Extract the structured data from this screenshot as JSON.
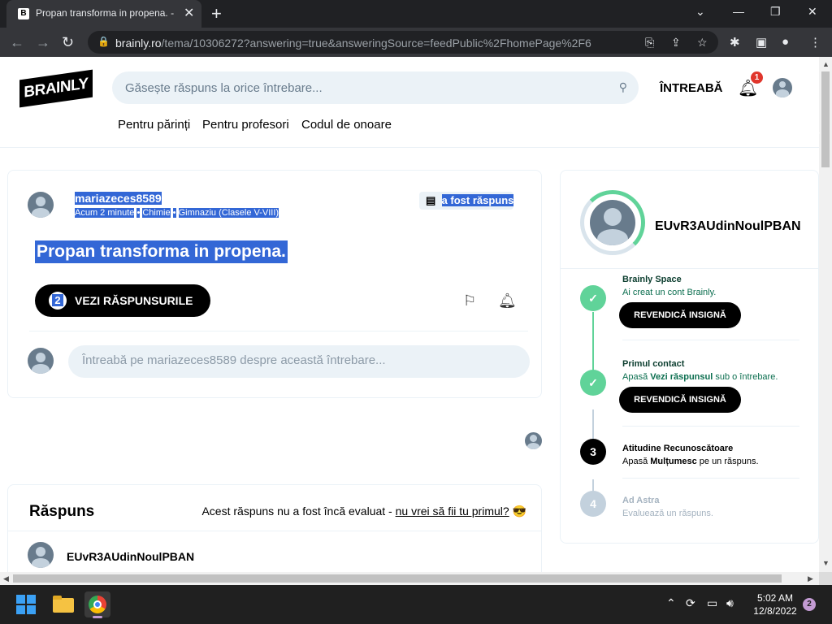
{
  "browser": {
    "tab_title": "Propan transforma in propena. -",
    "tab_favicon": "B",
    "url_host": "brainly.ro",
    "url_path": "/tema/10306272?answering=true&answeringSource=feedPublic%2FhomePage%2F6"
  },
  "header": {
    "logo": "BRAINLY",
    "search_placeholder": "Găsește răspuns la orice întrebare...",
    "ask_label": "ÎNTREABĂ",
    "notification_count": "1",
    "nav": [
      "Pentru părinți",
      "Pentru profesori",
      "Codul de onoare"
    ]
  },
  "question": {
    "author": "mariazeces8589",
    "time": "Acum 2 minute",
    "subject": "Chimie",
    "level": "Gimnaziu (Clasele V-VIII)",
    "status": "a fost răspuns",
    "title": "Propan transforma in propena.",
    "answers_count": "2",
    "view_answers_label": "VEZI RĂSPUNSURILE",
    "comment_placeholder": "Întreabă pe mariazeces8589 despre această întrebare..."
  },
  "answer": {
    "heading": "Răspuns",
    "note_prefix": "Acest răspuns nu a fost încă evaluat - ",
    "note_link": "nu vrei să fii tu primul?",
    "note_emoji": "😎",
    "author": "EUvR3AUdinNoulPBAN"
  },
  "sidebar": {
    "username": "EUvR3AUdinNoulPBAN",
    "steps": [
      {
        "marker": "✓",
        "title": "Brainly Space",
        "desc": "Ai creat un cont Brainly.",
        "button": "REVENDICĂ INSIGNĂ"
      },
      {
        "marker": "✓",
        "title": "Primul contact",
        "desc_pre": "Apasă ",
        "desc_bold": "Vezi răspunsul",
        "desc_post": " sub o întrebare.",
        "button": "REVENDICĂ INSIGNĂ"
      },
      {
        "marker": "3",
        "title": "Atitudine Recunoscătoare",
        "desc_pre": "Apasă ",
        "desc_bold": "Mulțumesc",
        "desc_post": " pe un răspuns."
      },
      {
        "marker": "4",
        "title": "Ad Astra",
        "desc": "Evaluează un răspuns."
      }
    ]
  },
  "taskbar": {
    "time": "5:02 AM",
    "date": "12/8/2022",
    "notifications": "2"
  },
  "colors": {
    "accent_green": "#60d399",
    "selection_blue": "#3367d6",
    "badge_red": "#e0362c"
  }
}
